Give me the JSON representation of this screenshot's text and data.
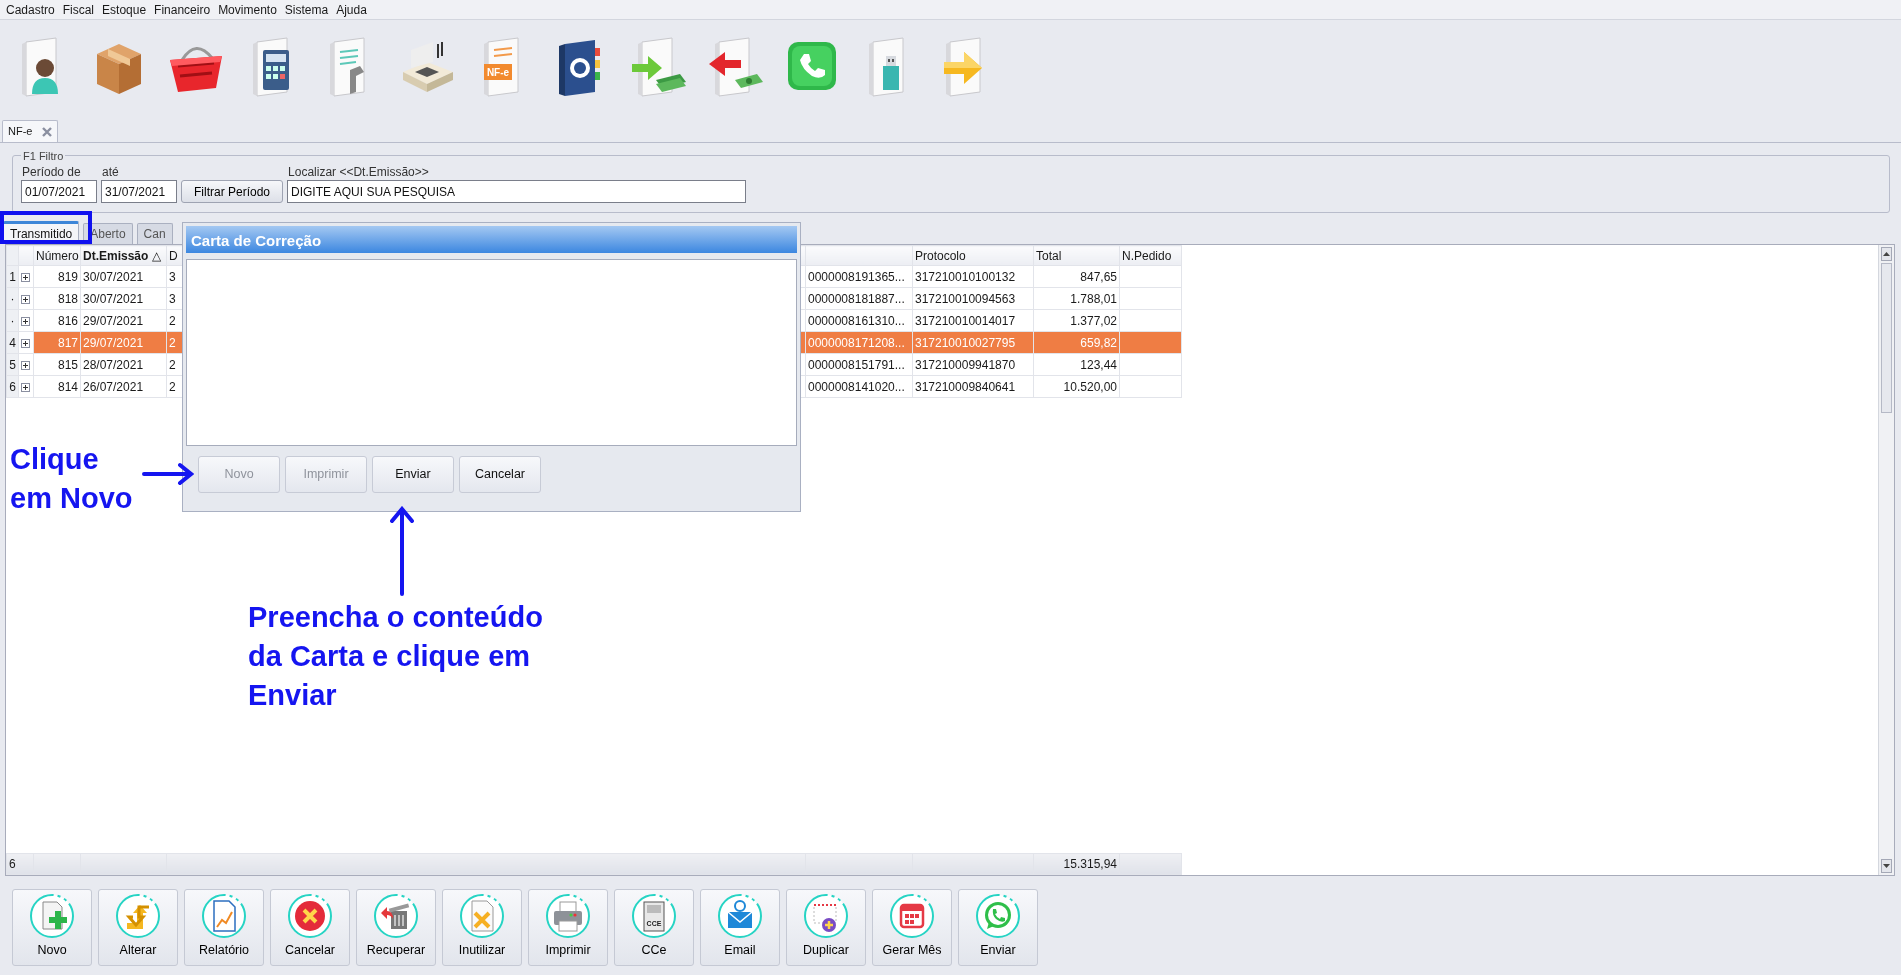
{
  "menu": [
    "Cadastro",
    "Fiscal",
    "Estoque",
    "Financeiro",
    "Movimento",
    "Sistema",
    "Ajuda"
  ],
  "toolbar": [
    {
      "kind": "user"
    },
    {
      "kind": "box"
    },
    {
      "kind": "basket"
    },
    {
      "kind": "calculator"
    },
    {
      "kind": "wrench"
    },
    {
      "kind": "register"
    },
    {
      "kind": "nfe",
      "text": "NF-e"
    },
    {
      "kind": "ledger"
    },
    {
      "kind": "moneyin"
    },
    {
      "kind": "moneyout"
    },
    {
      "kind": "phone"
    },
    {
      "kind": "usb"
    },
    {
      "kind": "exit"
    }
  ],
  "document_tab": {
    "label": "NF-e"
  },
  "filter": {
    "title": "F1 Filtro",
    "from_label": "Período de",
    "from_value": "01/07/2021",
    "to_label": "até",
    "to_value": "31/07/2021",
    "button": "Filtrar Período",
    "search_label": "Localizar <<Dt.Emissão>>",
    "search_value": "DIGITE AQUI SUA PESQUISA"
  },
  "tabs": [
    {
      "label": "Transmitido",
      "selected": true
    },
    {
      "label": "Aberto",
      "selected": false
    },
    {
      "label": "Can",
      "selected": false
    }
  ],
  "grid": {
    "columns": [
      "Número",
      "Dt.Emissão",
      "D",
      "Protocolo",
      "Total",
      "N.Pedido"
    ],
    "sorted_column_mark": "△",
    "rows": [
      {
        "indicator": "1",
        "numero": "819",
        "dt_emissao": "30/07/2021",
        "column_3": "3",
        "chave": "0000008191365...",
        "protocolo": "317210010100132",
        "total": "847,65",
        "selected": false
      },
      {
        "indicator": "·",
        "numero": "818",
        "dt_emissao": "30/07/2021",
        "column_3": "3",
        "chave": "0000008181887...",
        "protocolo": "317210010094563",
        "total": "1.788,01",
        "selected": false
      },
      {
        "indicator": "·",
        "numero": "816",
        "dt_emissao": "29/07/2021",
        "column_3": "2",
        "chave": "0000008161310...",
        "protocolo": "317210010014017",
        "total": "1.377,02",
        "selected": false
      },
      {
        "indicator": "4",
        "numero": "817",
        "dt_emissao": "29/07/2021",
        "column_3": "2",
        "chave": "0000008171208...",
        "protocolo": "317210010027795",
        "total": "659,82",
        "selected": true
      },
      {
        "indicator": "5",
        "numero": "815",
        "dt_emissao": "28/07/2021",
        "column_3": "2",
        "chave": "0000008151791...",
        "protocolo": "317210009941870",
        "total": "123,44",
        "selected": false
      },
      {
        "indicator": "6",
        "numero": "814",
        "dt_emissao": "26/07/2021",
        "column_3": "2",
        "chave": "0000008141020...",
        "protocolo": "317210009840641",
        "total": "10.520,00",
        "selected": false
      }
    ],
    "footer": {
      "count": "6",
      "total": "15.315,94"
    }
  },
  "bottom_buttons": [
    {
      "label": "Novo",
      "kind": "new"
    },
    {
      "label": "Alterar",
      "kind": "swap"
    },
    {
      "label": "Relatório",
      "kind": "chart"
    },
    {
      "label": "Cancelar",
      "kind": "cancel"
    },
    {
      "label": "Recuperar",
      "kind": "recover"
    },
    {
      "label": "Inutilizar",
      "kind": "void"
    },
    {
      "label": "Imprimir",
      "kind": "print"
    },
    {
      "label": "CCe",
      "kind": "cce",
      "text": "CCE"
    },
    {
      "label": "Email",
      "kind": "email"
    },
    {
      "label": "Duplicar",
      "kind": "duplicate"
    },
    {
      "label": "Gerar Mês",
      "kind": "calendar"
    },
    {
      "label": "Enviar",
      "kind": "chat"
    }
  ],
  "dialog": {
    "title": "Carta de Correção",
    "buttons": [
      {
        "label": "Novo",
        "disabled": true
      },
      {
        "label": "Imprimir",
        "disabled": true
      },
      {
        "label": "Enviar",
        "disabled": false
      },
      {
        "label": "Cancelar",
        "disabled": false
      }
    ]
  },
  "annotations": [
    {
      "kind": "frame"
    },
    {
      "kind": "label",
      "text": "Clique\nem Novo"
    },
    {
      "kind": "rightarrow"
    },
    {
      "kind": "uparrow"
    },
    {
      "kind": "label",
      "text": "Preencha o conteúdo\nda Carta e clique em\nEnviar"
    }
  ]
}
